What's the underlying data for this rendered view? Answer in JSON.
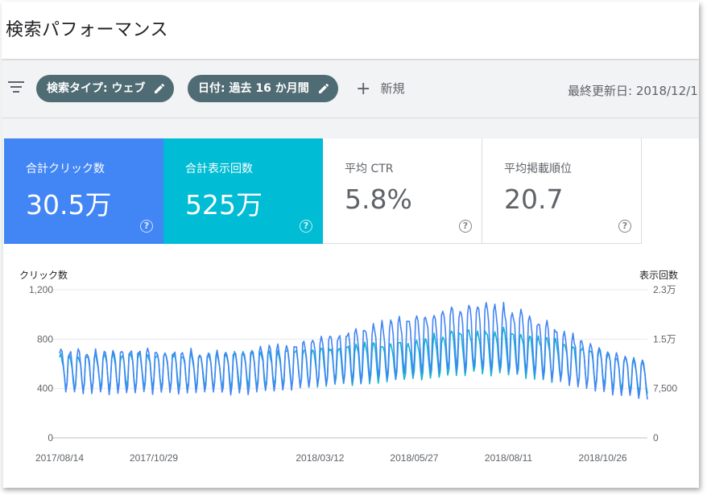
{
  "header": {
    "title": "検索パフォーマンス"
  },
  "filters": {
    "search_type_chip": "検索タイプ: ウェブ",
    "date_chip": "日付: 過去 16 か月間",
    "new_label": "新規",
    "last_updated": "最終更新日: 2018/12/1"
  },
  "metrics": [
    {
      "label": "合計クリック数",
      "value": "30.5万",
      "selected": true,
      "color": "#4285f4"
    },
    {
      "label": "合計表示回数",
      "value": "525万",
      "selected": true,
      "color": "#00bcd4"
    },
    {
      "label": "平均 CTR",
      "value": "5.8%",
      "selected": false
    },
    {
      "label": "平均掲載順位",
      "value": "20.7",
      "selected": false
    }
  ],
  "help_glyph": "?",
  "icons": {
    "filter": "filter-list-icon",
    "edit": "pencil-icon",
    "add": "plus-icon",
    "help": "help-circle-icon"
  },
  "chart_data": {
    "type": "line",
    "y_left_label": "クリック数",
    "y_right_label": "表示回数",
    "y_left_ticks": [
      "0",
      "400",
      "800",
      "1,200"
    ],
    "y_right_ticks": [
      "0",
      "7,500",
      "1.5万",
      "2.3万"
    ],
    "ylim_left": [
      0,
      1200
    ],
    "ylim_right": [
      0,
      23000
    ],
    "x_ticks": [
      "2017/08/14",
      "2017/10/29",
      "2018/03/12",
      "2018/05/27",
      "2018/08/11",
      "2018/10/26"
    ],
    "grid": true,
    "series": [
      {
        "name": "合計クリック数",
        "axis": "left",
        "color": "#4285f4",
        "anchors": [
          {
            "x": "2017/08/14",
            "y": 560
          },
          {
            "x": "2017/10/29",
            "y": 560
          },
          {
            "x": "2018/01/10",
            "y": 550
          },
          {
            "x": "2018/03/12",
            "y": 640
          },
          {
            "x": "2018/05/27",
            "y": 790
          },
          {
            "x": "2018/07/15",
            "y": 860
          },
          {
            "x": "2018/08/11",
            "y": 840
          },
          {
            "x": "2018/10/26",
            "y": 580
          },
          {
            "x": "2018/12/01",
            "y": 470
          }
        ]
      },
      {
        "name": "合計表示回数",
        "axis": "right",
        "color": "#12b5cb",
        "anchors": [
          {
            "x": "2017/08/14",
            "y": 10500
          },
          {
            "x": "2017/10/29",
            "y": 10800
          },
          {
            "x": "2018/01/10",
            "y": 10800
          },
          {
            "x": "2018/03/12",
            "y": 11500
          },
          {
            "x": "2018/05/27",
            "y": 12500
          },
          {
            "x": "2018/07/15",
            "y": 14000
          },
          {
            "x": "2018/08/11",
            "y": 13800
          },
          {
            "x": "2018/10/26",
            "y": 11000
          },
          {
            "x": "2018/12/01",
            "y": 9500
          }
        ]
      }
    ]
  }
}
